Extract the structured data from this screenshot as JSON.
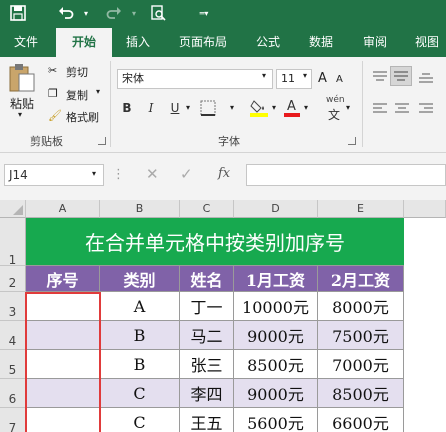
{
  "qat": {
    "save_icon": "save-icon",
    "undo_icon": "undo-icon",
    "redo_icon": "redo-icon",
    "preview_icon": "print-preview-icon"
  },
  "tabs": [
    "文件",
    "开始",
    "插入",
    "页面布局",
    "公式",
    "数据",
    "审阅",
    "视图"
  ],
  "ribbon": {
    "clipboard": {
      "paste": "粘贴",
      "cut": "剪切",
      "copy": "复制",
      "format_painter": "格式刷",
      "label": "剪贴板"
    },
    "font": {
      "name": "宋体",
      "size": "11",
      "bold": "B",
      "italic": "I",
      "underline": "U",
      "label": "字体",
      "wen": "wén",
      "font_size_up": "A",
      "font_size_down": "A"
    }
  },
  "formula_bar": {
    "name_box": "J14",
    "fx": "fx",
    "value": ""
  },
  "columns": [
    "A",
    "B",
    "C",
    "D",
    "E"
  ],
  "rows": [
    "1",
    "2",
    "3",
    "4",
    "5",
    "6",
    "7"
  ],
  "sheet": {
    "title": "在合并单元格中按类别加序号",
    "headers": [
      "序号",
      "类别",
      "姓名",
      "1月工资",
      "2月工资"
    ],
    "data": [
      [
        "",
        "A",
        "丁一",
        "10000元",
        "8000元"
      ],
      [
        "",
        "B",
        "马二",
        "9000元",
        "7500元"
      ],
      [
        "",
        "B",
        "张三",
        "8500元",
        "7000元"
      ],
      [
        "",
        "C",
        "李四",
        "9000元",
        "8500元"
      ],
      [
        "",
        "C",
        "王五",
        "5600元",
        "6600元"
      ]
    ]
  },
  "colors": {
    "accent": "#217346",
    "title_bg": "#17a94f",
    "header_bg": "#8062a8",
    "row_even": "#ffffff",
    "row_odd": "#e4dfef",
    "selection": "#e03b3b"
  }
}
